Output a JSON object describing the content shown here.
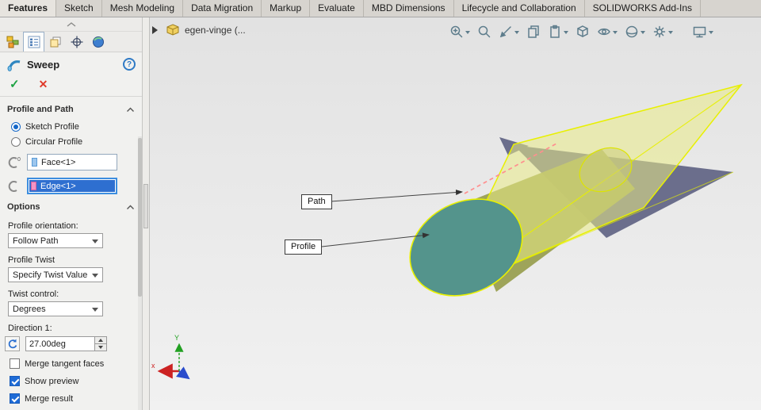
{
  "menubar": {
    "tabs": [
      {
        "label": "Features",
        "active": true
      },
      {
        "label": "Sketch",
        "active": false
      },
      {
        "label": "Mesh Modeling",
        "active": false
      },
      {
        "label": "Data Migration",
        "active": false
      },
      {
        "label": "Markup",
        "active": false
      },
      {
        "label": "Evaluate",
        "active": false
      },
      {
        "label": "MBD Dimensions",
        "active": false
      },
      {
        "label": "Lifecycle and Collaboration",
        "active": false
      },
      {
        "label": "SOLIDWORKS Add-Ins",
        "active": false
      }
    ]
  },
  "panel": {
    "title": "Sweep",
    "help_label": "?",
    "ok_icon": "✓",
    "cancel_icon": "✕",
    "tabs": [
      "feature-manager",
      "property-manager",
      "configuration-manager",
      "dimxpert-manager",
      "display-manager"
    ],
    "profile_and_path": {
      "header": "Profile and Path",
      "radios": [
        {
          "label": "Sketch Profile",
          "checked": true
        },
        {
          "label": "Circular Profile",
          "checked": false
        }
      ],
      "selections": [
        {
          "value": "Face<1>",
          "swatch_color": "#9cc6ee",
          "selected": false
        },
        {
          "value": "Edge<1>",
          "swatch_color": "#f394c4",
          "selected": true
        }
      ]
    },
    "options": {
      "header": "Options",
      "fields": [
        {
          "label": "Profile orientation:",
          "value": "Follow Path"
        },
        {
          "label": "Profile Twist",
          "value": "Specify Twist Value"
        },
        {
          "label": "Twist control:",
          "value": "Degrees"
        }
      ],
      "direction": {
        "label": "Direction 1:",
        "value": "27.00deg"
      },
      "checkboxes": [
        {
          "label": "Merge tangent faces",
          "checked": false
        },
        {
          "label": "Show preview",
          "checked": true
        },
        {
          "label": "Merge result",
          "checked": true
        }
      ]
    }
  },
  "viewport": {
    "document_name": "egen-vinge (...",
    "callouts": [
      {
        "label": "Path"
      },
      {
        "label": "Profile"
      }
    ],
    "toolbar_icons": [
      "zoom-in",
      "zoom-area",
      "section-view",
      "pages",
      "clipboard",
      "view-orientation-cube",
      "hide-show-eye",
      "appearance-sphere",
      "view-settings-gear",
      "full-screen-monitor"
    ],
    "triad": {
      "x_label": "x",
      "y_label": "Y"
    }
  },
  "colors": {
    "profile_face": "#54948c",
    "sweep_surface": "#eaeb86",
    "plane_surface": "#6b6e8c",
    "edge_highlight": "#e8f000",
    "path_dashed": "#ff8f8f",
    "selection_blue": "#2e6fd0"
  }
}
